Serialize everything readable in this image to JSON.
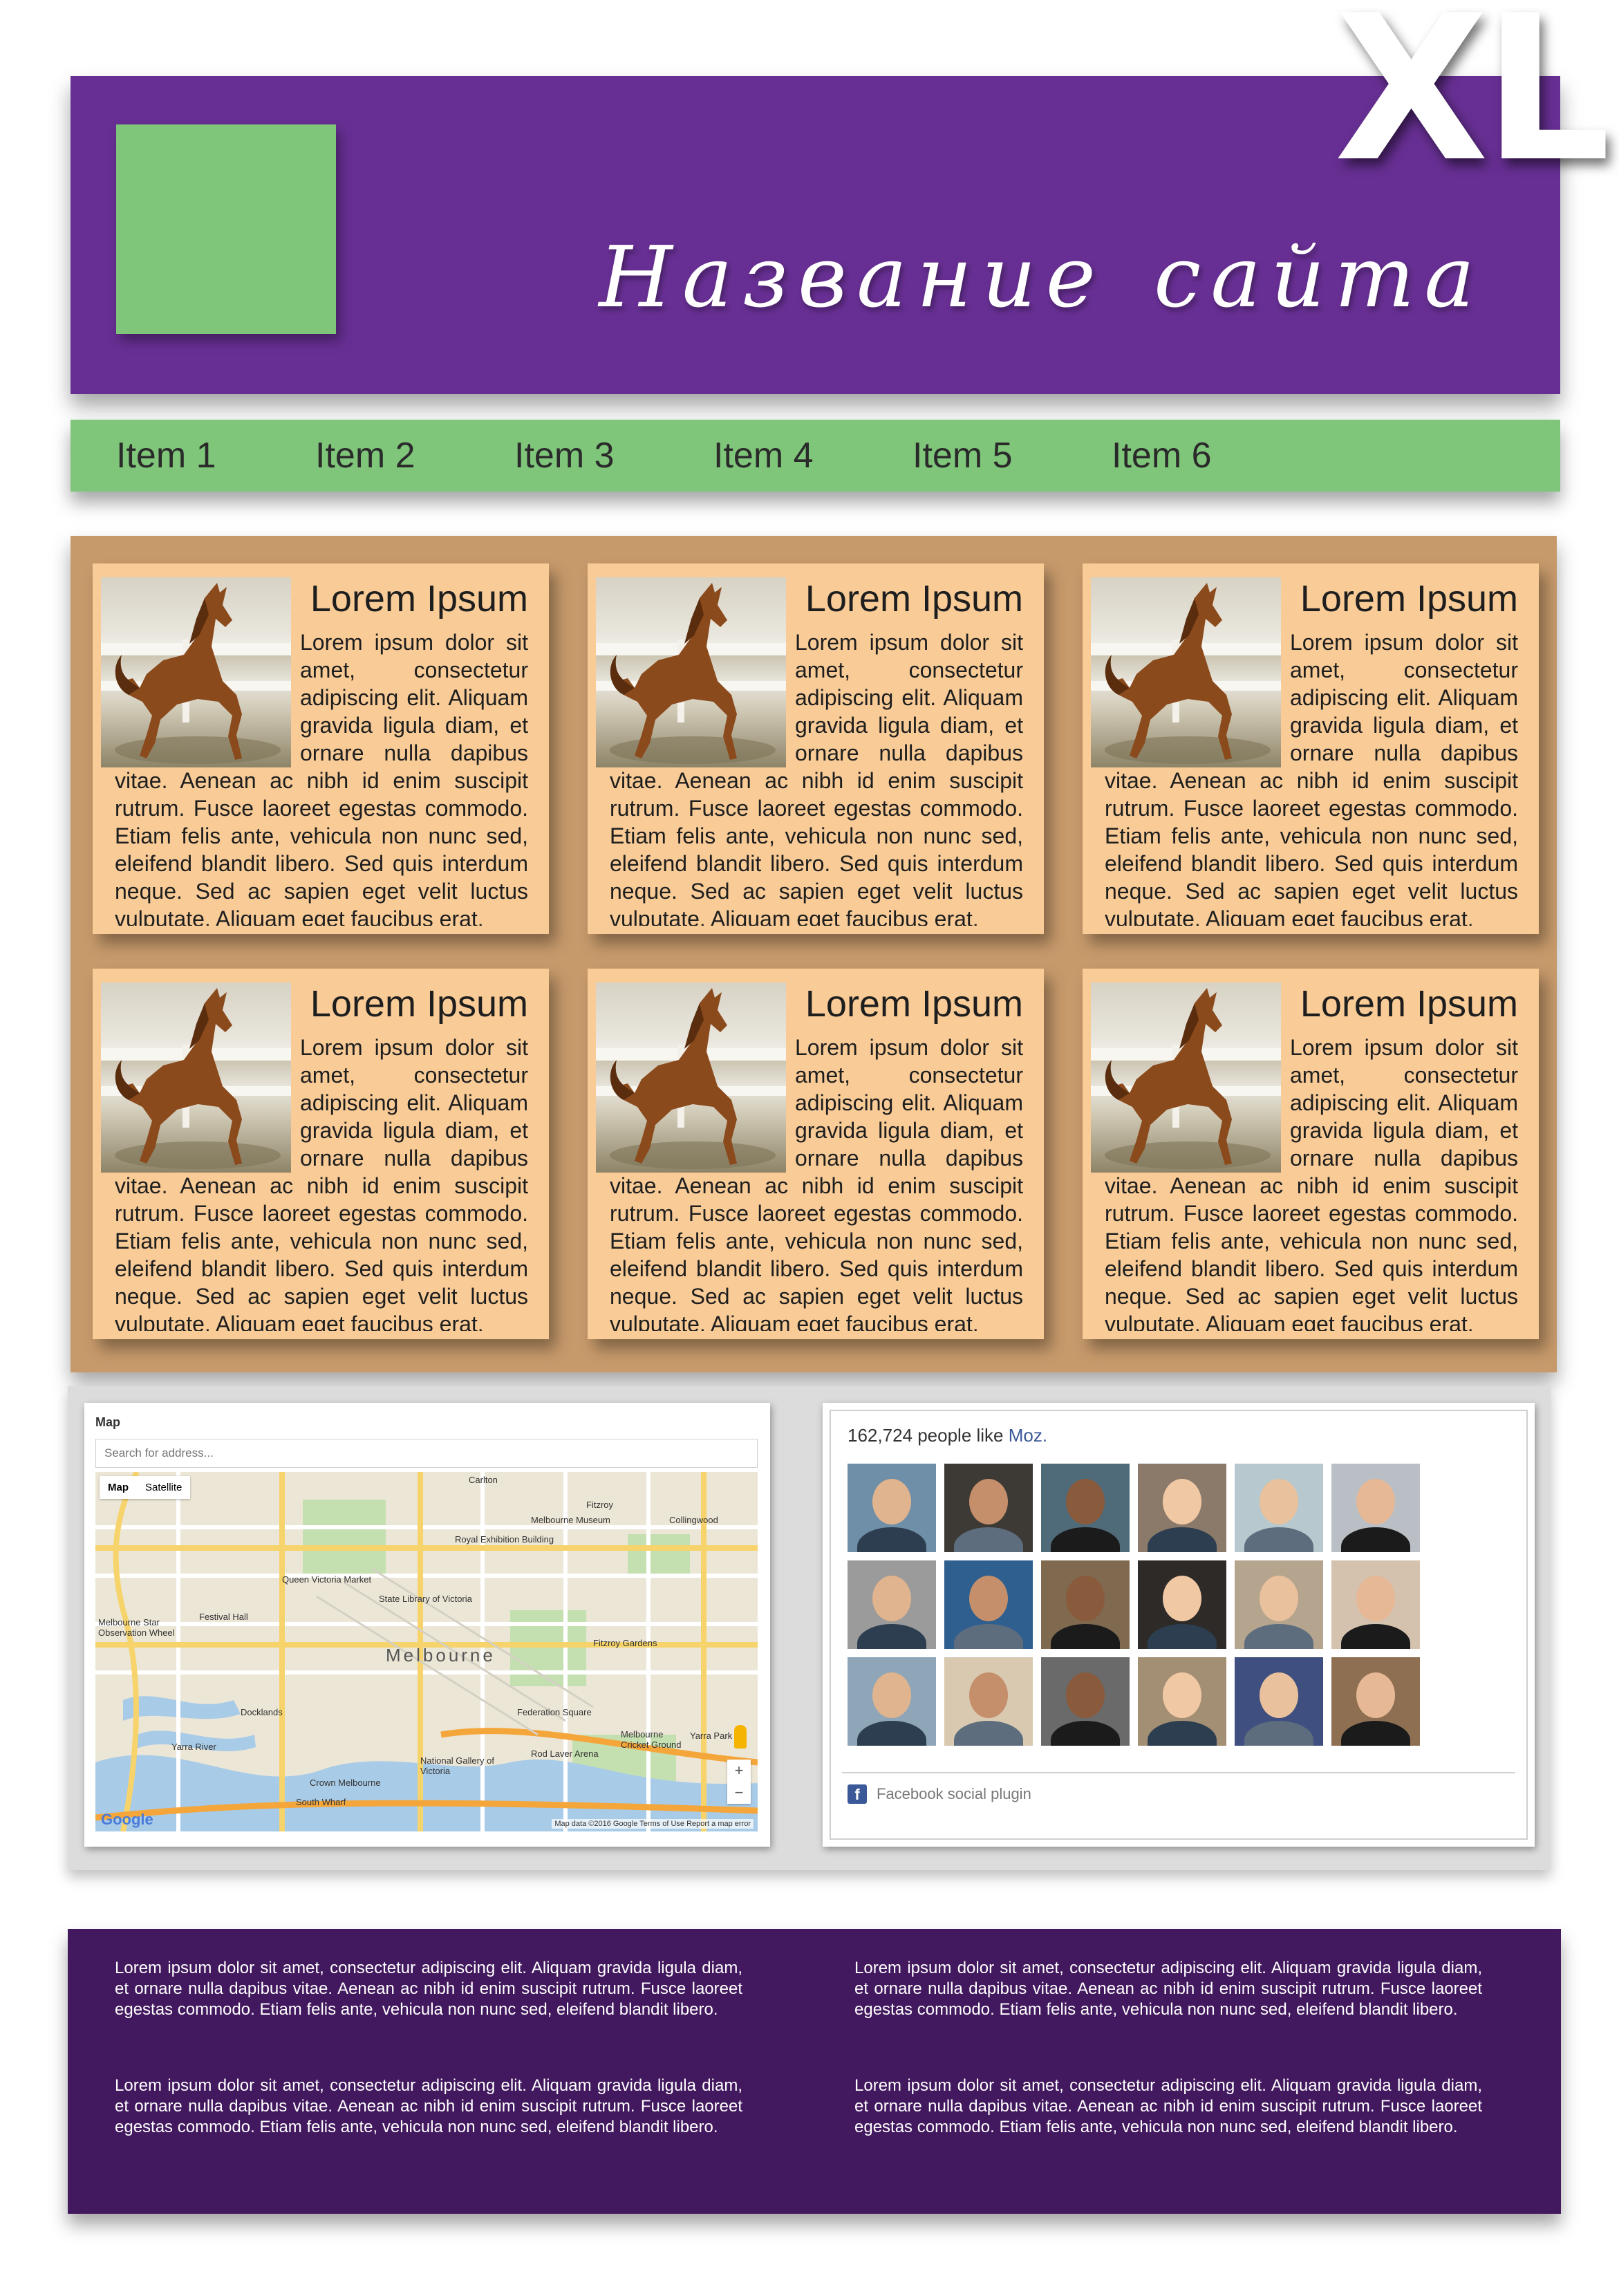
{
  "badge": {
    "text": "XL"
  },
  "header": {
    "title_word1": "Название",
    "title_word2": "сайта",
    "colors": {
      "header_bg": "#672f93",
      "logo": "#7fc67a"
    }
  },
  "nav": {
    "items": [
      {
        "label": "Item 1"
      },
      {
        "label": "Item 2"
      },
      {
        "label": "Item 3"
      },
      {
        "label": "Item 4"
      },
      {
        "label": "Item 5"
      },
      {
        "label": "Item 6"
      }
    ],
    "colors": {
      "bg": "#7fc67a"
    }
  },
  "cards": [
    {
      "title": "Lorem Ipsum",
      "image": "horse-photo",
      "text": "Lorem ipsum dolor sit amet, consectetur adipiscing elit. Aliquam gravida ligula diam, et ornare nulla dapibus vitae. Aenean ac nibh id enim suscipit rutrum. Fusce laoreet egestas commodo. Etiam felis ante, vehicula non nunc sed, eleifend blandit libero. Sed quis interdum neque. Sed ac sapien eget velit luctus vulputate. Aliquam eget faucibus erat."
    },
    {
      "title": "Lorem Ipsum",
      "image": "horse-photo",
      "text": "Lorem ipsum dolor sit amet, consectetur adipiscing elit. Aliquam gravida ligula diam, et ornare nulla dapibus vitae. Aenean ac nibh id enim suscipit rutrum. Fusce laoreet egestas commodo. Etiam felis ante, vehicula non nunc sed, eleifend blandit libero. Sed quis interdum neque. Sed ac sapien eget velit luctus vulputate. Aliquam eget faucibus erat."
    },
    {
      "title": "Lorem Ipsum",
      "image": "horse-photo",
      "text": "Lorem ipsum dolor sit amet, consectetur adipiscing elit. Aliquam gravida ligula diam, et ornare nulla dapibus vitae. Aenean ac nibh id enim suscipit rutrum. Fusce laoreet egestas commodo. Etiam felis ante, vehicula non nunc sed, eleifend blandit libero. Sed quis interdum neque. Sed ac sapien eget velit luctus vulputate. Aliquam eget faucibus erat."
    },
    {
      "title": "Lorem Ipsum",
      "image": "horse-photo",
      "text": "Lorem ipsum dolor sit amet, consectetur adipiscing elit. Aliquam gravida ligula diam, et ornare nulla dapibus vitae. Aenean ac nibh id enim suscipit rutrum. Fusce laoreet egestas commodo. Etiam felis ante, vehicula non nunc sed, eleifend blandit libero. Sed quis interdum neque. Sed ac sapien eget velit luctus vulputate. Aliquam eget faucibus erat."
    },
    {
      "title": "Lorem Ipsum",
      "image": "horse-photo",
      "text": "Lorem ipsum dolor sit amet, consectetur adipiscing elit. Aliquam gravida ligula diam, et ornare nulla dapibus vitae. Aenean ac nibh id enim suscipit rutrum. Fusce laoreet egestas commodo. Etiam felis ante, vehicula non nunc sed, eleifend blandit libero. Sed quis interdum neque. Sed ac sapien eget velit luctus vulputate. Aliquam eget faucibus erat."
    },
    {
      "title": "Lorem Ipsum",
      "image": "horse-photo",
      "text": "Lorem ipsum dolor sit amet, consectetur adipiscing elit. Aliquam gravida ligula diam, et ornare nulla dapibus vitae. Aenean ac nibh id enim suscipit rutrum. Fusce laoreet egestas commodo. Etiam felis ante, vehicula non nunc sed, eleifend blandit libero. Sed quis interdum neque. Sed ac sapien eget velit luctus vulputate. Aliquam eget faucibus erat."
    }
  ],
  "content_colors": {
    "area_bg": "#c79a6b",
    "card_bg": "#f8cb97"
  },
  "map_widget": {
    "title": "Map",
    "search_placeholder": "Search for address...",
    "map_type_buttons": [
      "Map",
      "Satellite"
    ],
    "zoom_in": "+",
    "zoom_out": "−",
    "google_logo": "Google",
    "attribution": "Map data ©2016 Google  Terms of Use  Report a map error",
    "labels": {
      "melbourne": "Melbourne",
      "carlton": "Carlton",
      "fitzroy": "Fitzroy",
      "collingwood": "Collingwood",
      "docklands": "Docklands",
      "southwharf": "South Wharf",
      "yarra_river": "Yarra River",
      "museum": "Melbourne Museum",
      "queen_victoria_market": "Queen Victoria Market",
      "state_library": "State Library of Victoria",
      "federation_square": "Federation Square",
      "fitzroy_gardens": "Fitzroy Gardens",
      "royal_exhibition": "Royal Exhibition Building",
      "star_wheel": "Melbourne Star Observation Wheel",
      "festival_hall": "Festival Hall",
      "national_gallery": "National Gallery of Victoria",
      "rod_laver": "Rod Laver Arena",
      "crown": "Crown Melbourne",
      "mcg": "Melbourne Cricket Ground",
      "yarra_park": "Yarra Park"
    }
  },
  "fb_widget": {
    "count_text": "162,724 people like ",
    "brand": "Moz.",
    "plugin_label": "Facebook social plugin",
    "faces": [
      "avatar-1",
      "avatar-2",
      "avatar-3",
      "avatar-4",
      "avatar-5",
      "avatar-6",
      "avatar-7",
      "avatar-8",
      "avatar-9",
      "avatar-10",
      "avatar-11",
      "avatar-12",
      "avatar-13",
      "avatar-14",
      "avatar-15",
      "avatar-16",
      "avatar-17",
      "avatar-18"
    ]
  },
  "footer": {
    "paragraphs": [
      "Lorem ipsum dolor sit amet, consectetur adipiscing elit. Aliquam gravida ligula diam, et ornare nulla dapibus vitae. Aenean ac nibh id enim suscipit rutrum. Fusce laoreet egestas commodo. Etiam felis ante, vehicula non nunc sed, eleifend blandit libero.",
      "Lorem ipsum dolor sit amet, consectetur adipiscing elit. Aliquam gravida ligula diam, et ornare nulla dapibus vitae. Aenean ac nibh id enim suscipit rutrum. Fusce laoreet egestas commodo. Etiam felis ante, vehicula non nunc sed, eleifend blandit libero.",
      "Lorem ipsum dolor sit amet, consectetur adipiscing elit. Aliquam gravida ligula diam, et ornare nulla dapibus vitae. Aenean ac nibh id enim suscipit rutrum. Fusce laoreet egestas commodo. Etiam felis ante, vehicula non nunc sed, eleifend blandit libero.",
      "Lorem ipsum dolor sit amet, consectetur adipiscing elit. Aliquam gravida ligula diam, et ornare nulla dapibus vitae. Aenean ac nibh id enim suscipit rutrum. Fusce laoreet egestas commodo. Etiam felis ante, vehicula non nunc sed, eleifend blandit libero."
    ],
    "colors": {
      "bg": "#42185e"
    }
  }
}
